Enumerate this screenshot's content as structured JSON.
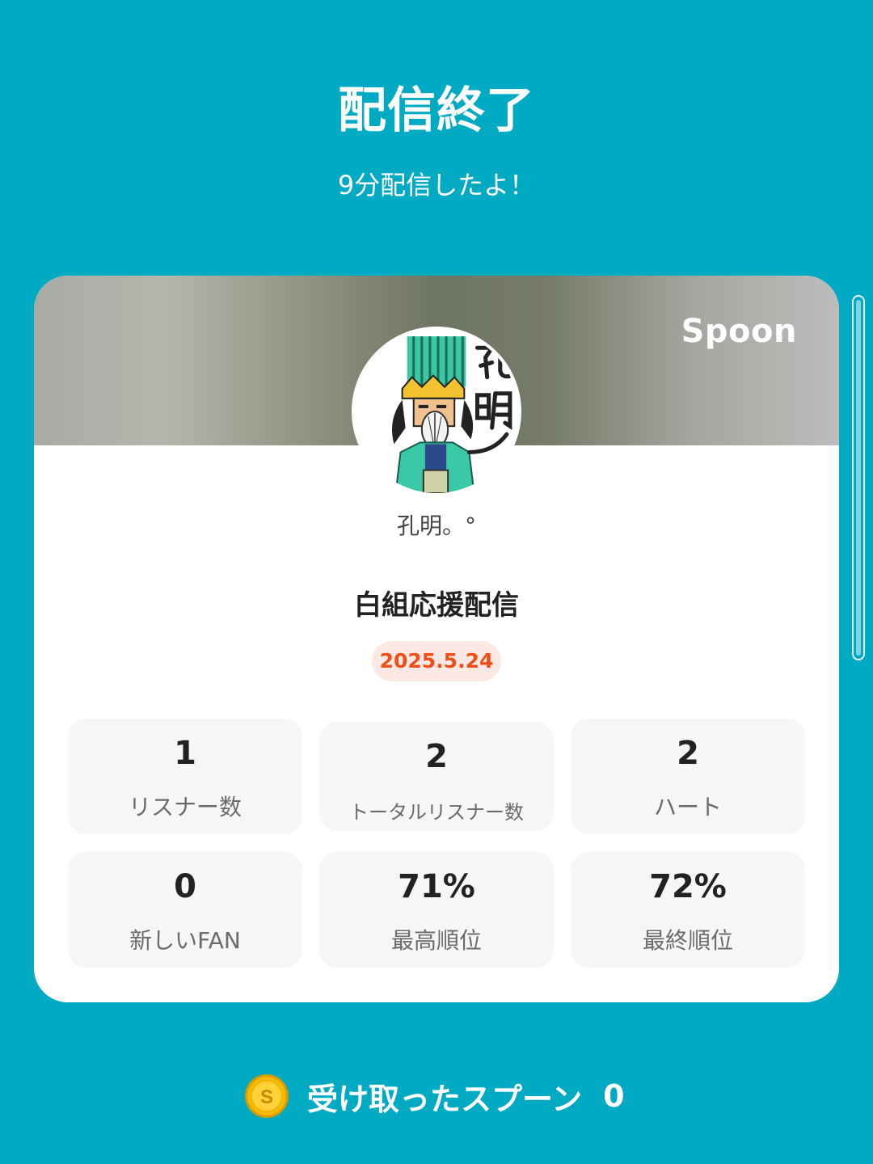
{
  "header": {
    "title": "配信終了",
    "subtitle": "9分配信したよ！"
  },
  "card": {
    "brand": "Spoon",
    "avatar_icon": "user-avatar-icon",
    "username": "孔明。°",
    "stream_title": "白組応援配信",
    "date": "2025.5.24",
    "stats": [
      {
        "value": "1",
        "label": "リスナー数"
      },
      {
        "value": "2",
        "label": "トータルリスナー数"
      },
      {
        "value": "2",
        "label": "ハート"
      },
      {
        "value": "0",
        "label": "新しいFAN"
      },
      {
        "value": "71%",
        "label": "最高順位"
      },
      {
        "value": "72%",
        "label": "最終順位"
      }
    ]
  },
  "spoons": {
    "icon": "spoon-coin-icon",
    "label": "受け取ったスプーン",
    "value": "0"
  },
  "colors": {
    "background": "#00aac3",
    "date_badge_text": "#ee4f19",
    "date_badge_bg": "#fde9e3",
    "coin": "#f5b800"
  }
}
